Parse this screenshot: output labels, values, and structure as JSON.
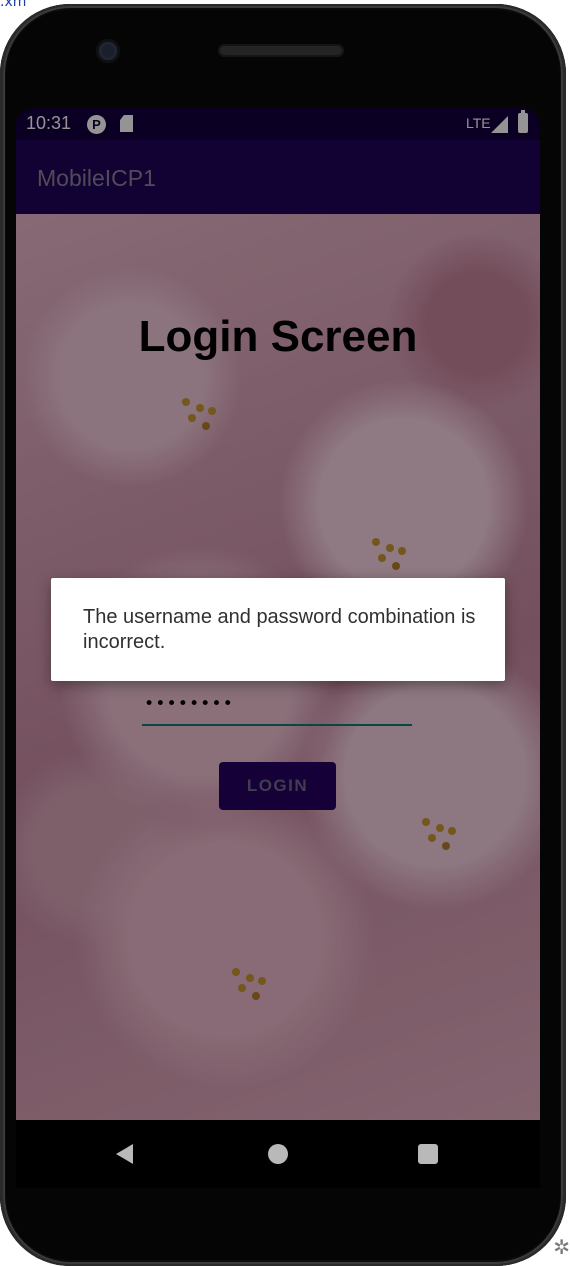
{
  "corner_text": ".xm",
  "status_bar": {
    "time": "10:31",
    "network": "LTE",
    "icons": [
      "p-icon",
      "sd-card-icon",
      "signal-icon",
      "battery-icon"
    ]
  },
  "app_bar": {
    "title": "MobileICP1"
  },
  "login": {
    "title": "Login Screen",
    "password_value": "••••••••",
    "button_label": "LOGIN"
  },
  "dialog": {
    "message": "The username and password combination is incorrect."
  },
  "nav_bar": {
    "icons": [
      "back-icon",
      "home-icon",
      "recents-icon"
    ]
  },
  "colors": {
    "status_bar": "#14003f",
    "app_bar": "#1e0458",
    "accent_underline": "#0f7d74",
    "button": "#25005f",
    "dialog_bg": "#ffffff"
  }
}
